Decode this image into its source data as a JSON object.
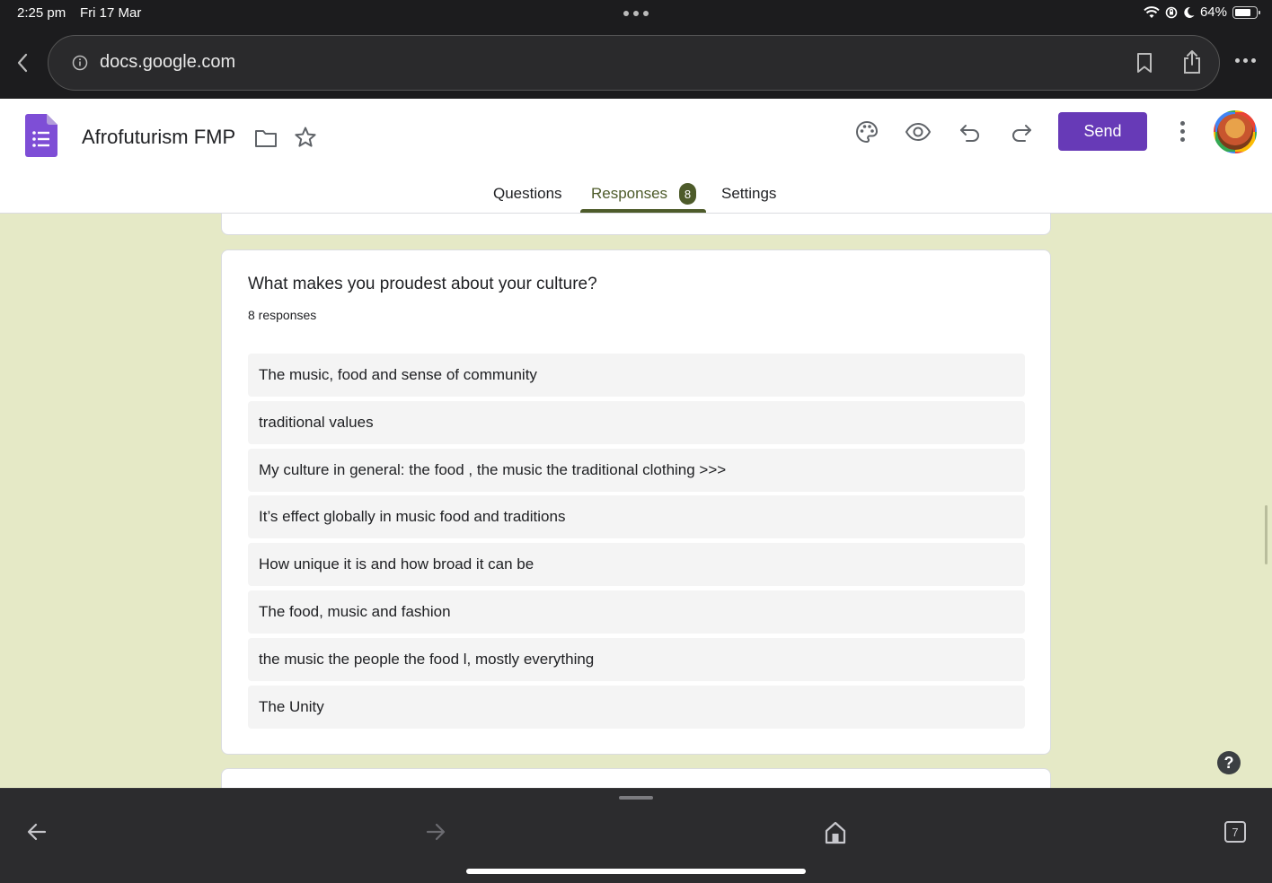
{
  "status_bar": {
    "time": "2:25 pm",
    "date": "Fri 17 Mar",
    "battery": "64%",
    "battery_level": 0.64
  },
  "browser": {
    "url": "docs.google.com"
  },
  "form_header": {
    "title": "Afrofuturism FMP",
    "send_label": "Send",
    "accent_color": "#673ab7"
  },
  "tabs": {
    "questions": "Questions",
    "responses": "Responses",
    "responses_badge": "8",
    "settings": "Settings",
    "active_color": "#4d5b2a"
  },
  "question_card": {
    "question": "What makes you proudest about your culture?",
    "response_count": "8 responses",
    "responses": [
      "The music, food and sense of community",
      "traditional values",
      "My culture in general: the food , the music the traditional clothing >>>",
      "It’s effect globally in music food and traditions",
      "How unique it is and how broad it can be",
      "The food, music and fashion",
      "the music the people the food l, mostly everything",
      "The Unity"
    ]
  },
  "help": "?",
  "bottom_toolbar": {
    "tab_count": "7"
  },
  "background_color": "#e5e9c6"
}
